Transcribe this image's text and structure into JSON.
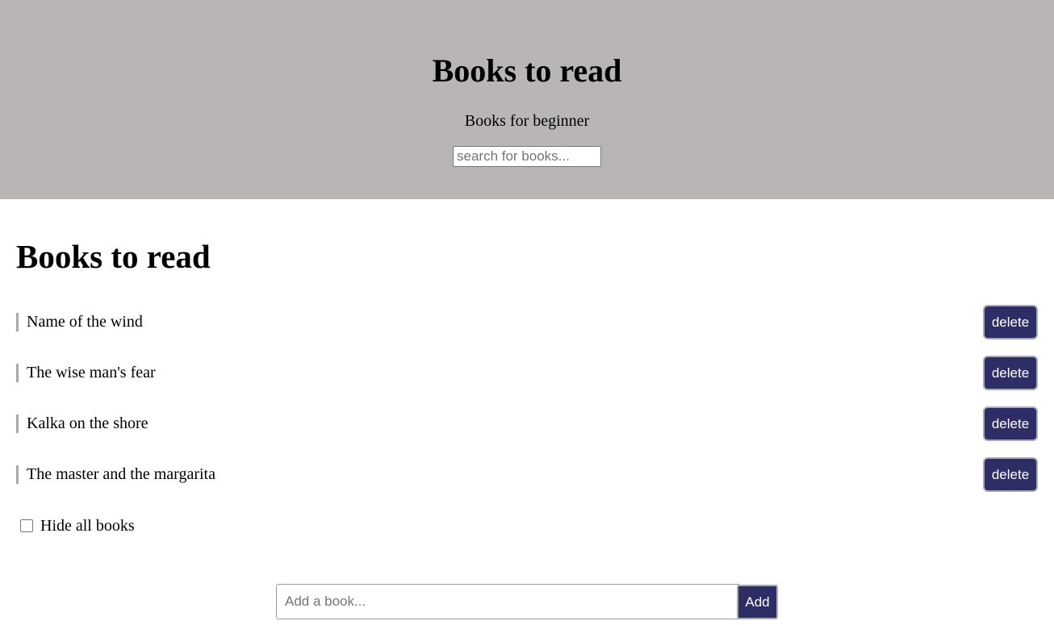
{
  "header": {
    "title": "Books to read",
    "subtitle": "Books for beginner",
    "search_placeholder": "search for books...",
    "background": "#bab5b5"
  },
  "list": {
    "title": "Books to read",
    "books": [
      {
        "name": "Name of the wind",
        "delete_label": "delete"
      },
      {
        "name": "The wise man's fear",
        "delete_label": "delete"
      },
      {
        "name": "Kalka on the shore",
        "delete_label": "delete"
      },
      {
        "name": "The master and the margarita",
        "delete_label": "delete"
      }
    ],
    "button_color": "#2f2d66"
  },
  "hide": {
    "label": "Hide all books",
    "checked": false
  },
  "add_form": {
    "placeholder": "Add a book...",
    "button_label": "Add"
  }
}
